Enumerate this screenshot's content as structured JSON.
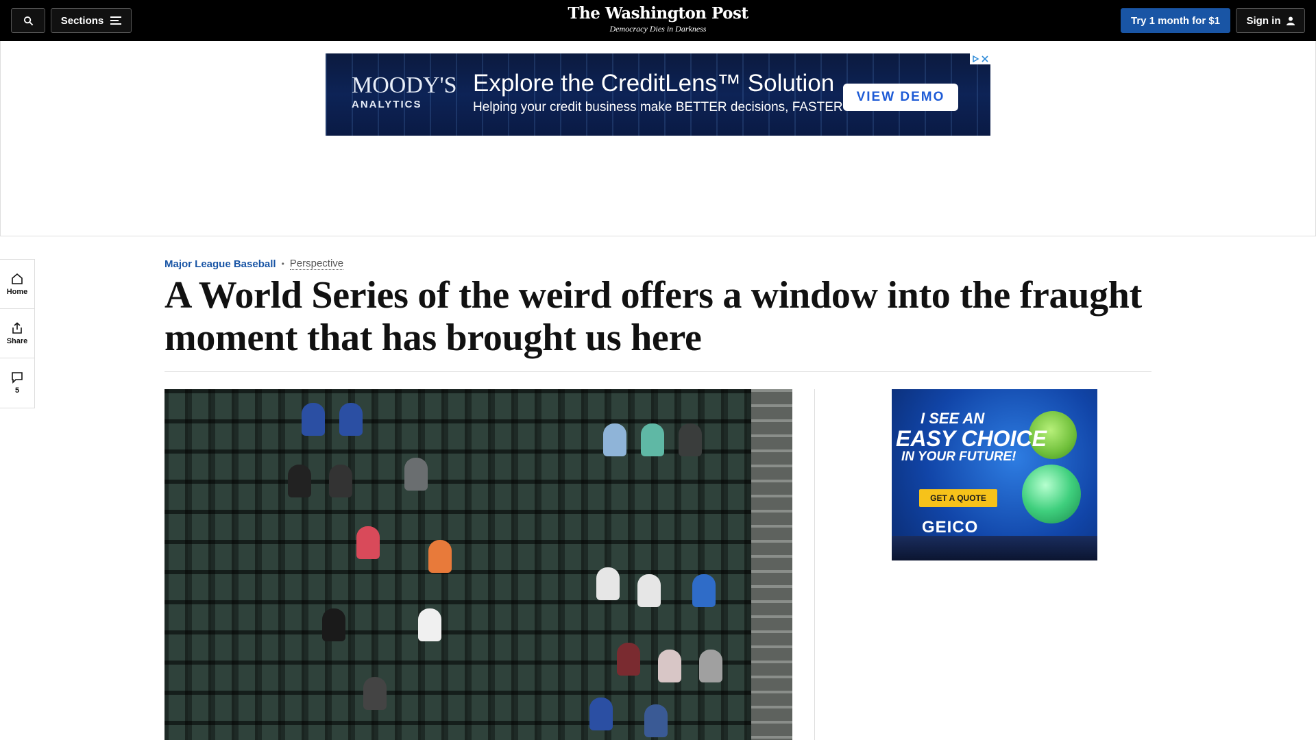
{
  "header": {
    "sections_label": "Sections",
    "logo": "The Washington Post",
    "tagline": "Democracy Dies in Darkness",
    "subscribe_label": "Try 1 month for $1",
    "signin_label": "Sign in"
  },
  "top_ad": {
    "brand": "MOODY'S",
    "brand_sub": "ANALYTICS",
    "headline": "Explore the CreditLens™ Solution",
    "subline": "Helping your credit business make BETTER decisions, FASTER",
    "cta": "VIEW DEMO"
  },
  "left_rail": {
    "home_label": "Home",
    "share_label": "Share",
    "comments_count": "5"
  },
  "article": {
    "section": "Major League Baseball",
    "label": "Perspective",
    "headline": "A World Series of the weird offers a window into the fraught moment that has brought us here"
  },
  "side_ad": {
    "line1": "I SEE AN",
    "line2": "EASY CHOICE",
    "line3": "IN YOUR FUTURE!",
    "cta": "GET A QUOTE",
    "brand": "GEICO"
  },
  "colors": {
    "accent": "#1955a5",
    "topbar": "#000000"
  }
}
